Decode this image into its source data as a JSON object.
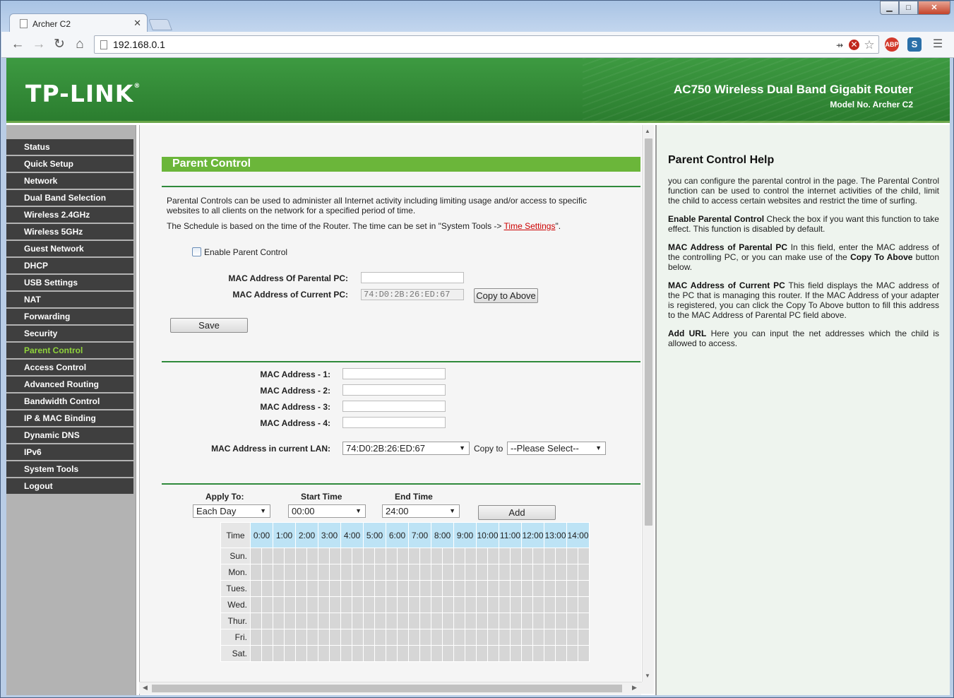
{
  "browser": {
    "tab_title": "Archer C2",
    "url": "192.168.0.1",
    "win_min": "▁",
    "win_max": "□",
    "win_close": "✕"
  },
  "banner": {
    "logo": "TP-LINK",
    "title": "AC750 Wireless Dual Band Gigabit Router",
    "model": "Model No. Archer C2"
  },
  "sidebar": {
    "items": [
      {
        "label": "Status"
      },
      {
        "label": "Quick Setup"
      },
      {
        "label": "Network"
      },
      {
        "label": "Dual Band Selection"
      },
      {
        "label": "Wireless 2.4GHz"
      },
      {
        "label": "Wireless 5GHz"
      },
      {
        "label": "Guest Network"
      },
      {
        "label": "DHCP"
      },
      {
        "label": "USB Settings"
      },
      {
        "label": "NAT"
      },
      {
        "label": "Forwarding"
      },
      {
        "label": "Security"
      },
      {
        "label": "Parent Control"
      },
      {
        "label": "Access Control"
      },
      {
        "label": "Advanced Routing"
      },
      {
        "label": "Bandwidth Control"
      },
      {
        "label": "IP & MAC Binding"
      },
      {
        "label": "Dynamic DNS"
      },
      {
        "label": "IPv6"
      },
      {
        "label": "System Tools"
      },
      {
        "label": "Logout"
      }
    ],
    "active": "Parent Control"
  },
  "main": {
    "heading": "Parent Control",
    "intro": "Parental Controls can be used to administer all Internet activity including limiting usage and/or access to specific websites to all clients on the network for a specified period of time.",
    "schedule_note": "The Schedule is based on the time of the Router. The time can be set in \"System Tools -> ",
    "schedule_link": " Time Settings",
    "schedule_end": "\".",
    "enable_label": "Enable Parent Control",
    "mac_parental_label": "MAC Address Of Parental PC:",
    "mac_parental_value": "",
    "mac_current_label": "MAC Address of Current PC:",
    "mac_current_value": "74:D0:2B:26:ED:67",
    "copy_above": "Copy to Above",
    "save": "Save",
    "mac_list": [
      {
        "label": "MAC Address - 1:",
        "value": ""
      },
      {
        "label": "MAC Address - 2:",
        "value": ""
      },
      {
        "label": "MAC Address - 3:",
        "value": ""
      },
      {
        "label": "MAC Address - 4:",
        "value": ""
      }
    ],
    "lan_label": "MAC Address in current LAN:",
    "lan_selected": "74:D0:2B:26:ED:67",
    "copy_to_label": "Copy to",
    "copy_to_selected": "--Please Select--",
    "apply_to_label": "Apply To:",
    "apply_to_selected": "Each Day",
    "start_label": "Start Time",
    "start_selected": "00:00",
    "end_label": "End Time",
    "end_selected": "24:00",
    "add": "Add",
    "schedule": {
      "corner": "Time",
      "hours": [
        "0:00",
        "1:00",
        "2:00",
        "3:00",
        "4:00",
        "5:00",
        "6:00",
        "7:00",
        "8:00",
        "9:00",
        "10:00",
        "11:00",
        "12:00",
        "13:00",
        "14:00"
      ],
      "days": [
        "Sun.",
        "Mon.",
        "Tues.",
        "Wed.",
        "Thur.",
        "Fri.",
        "Sat."
      ]
    }
  },
  "help": {
    "title": "Parent Control Help",
    "p1": "you can configure the parental control in the page. The Parental Control function can be used to control the internet activities of the child, limit the child to access certain websites and restrict the time of surfing.",
    "p2_bold": "Enable Parental Control",
    "p2": " Check the box if you want this function to take effect. This function is disabled by default.",
    "p3_bold": "MAC Address of Parental PC",
    "p3": " In this field, enter the MAC address of the controlling PC, or you can make use of the ",
    "p3_bold2": "Copy To Above",
    "p3_end": " button below.",
    "p4_bold": "MAC Address of Current PC",
    "p4": " This field displays the MAC address of the PC that is managing this router. If the MAC Address of your adapter is registered, you can click the Copy To Above button to fill this address to the MAC Address of Parental PC field above.",
    "p5_bold": "Add URL",
    "p5": " Here you can input the net addresses which the child is allowed to access."
  }
}
